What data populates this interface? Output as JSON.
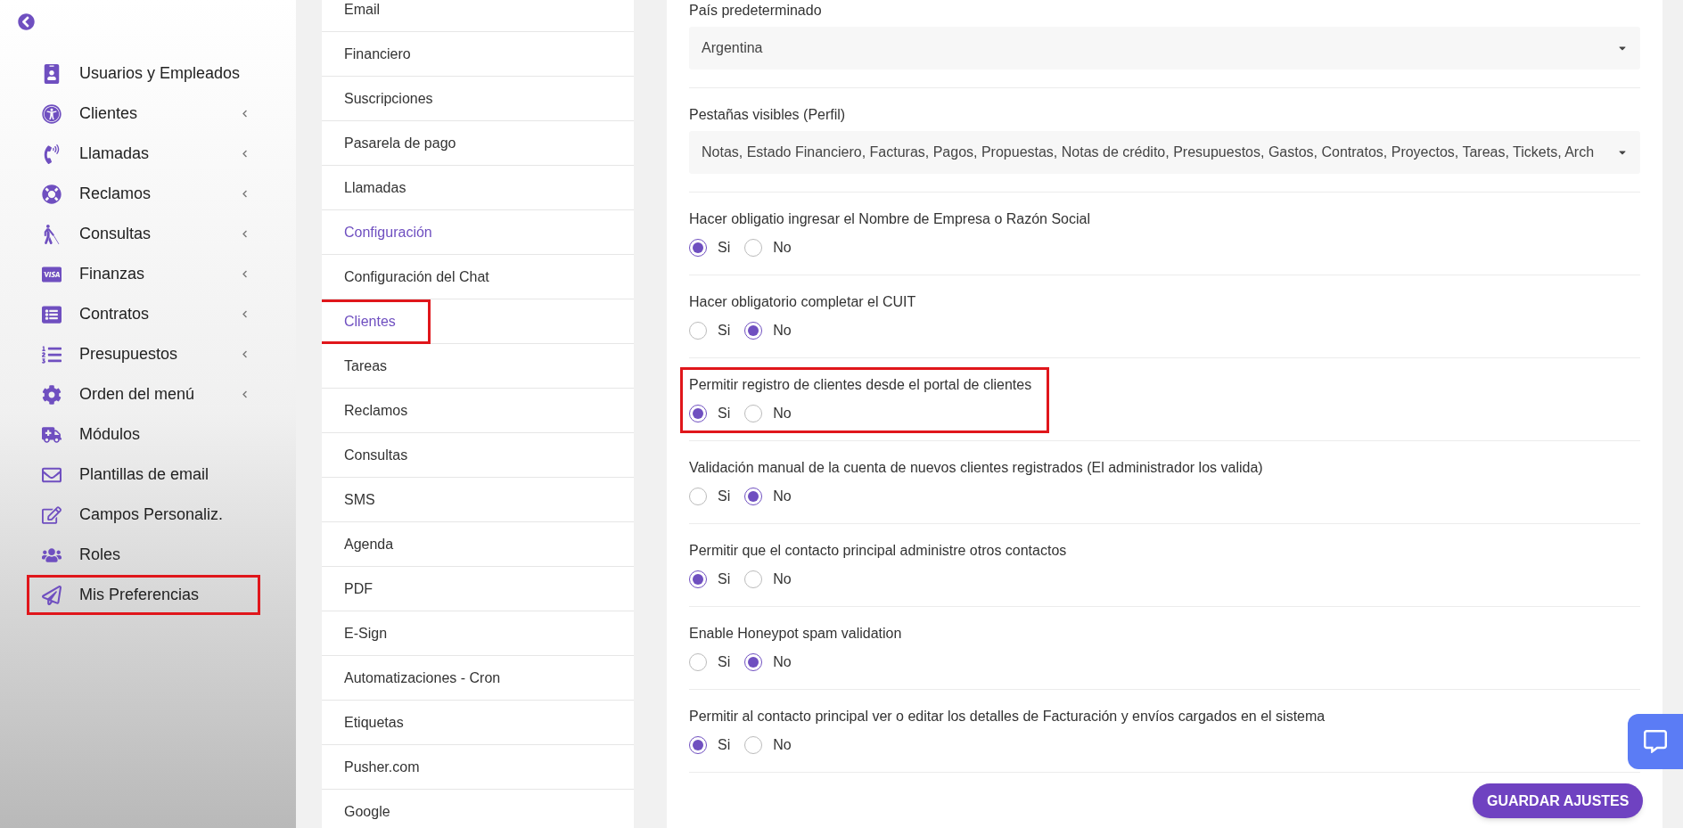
{
  "sidebar": {
    "items": [
      {
        "label": "Usuarios y Empleados",
        "has_submenu": false,
        "highlighted": false
      },
      {
        "label": "Clientes",
        "has_submenu": true,
        "highlighted": false
      },
      {
        "label": "Llamadas",
        "has_submenu": true,
        "highlighted": false
      },
      {
        "label": "Reclamos",
        "has_submenu": true,
        "highlighted": false
      },
      {
        "label": "Consultas",
        "has_submenu": true,
        "highlighted": false
      },
      {
        "label": "Finanzas",
        "has_submenu": true,
        "highlighted": false
      },
      {
        "label": "Contratos",
        "has_submenu": true,
        "highlighted": false
      },
      {
        "label": "Presupuestos",
        "has_submenu": true,
        "highlighted": false
      },
      {
        "label": "Orden del menú",
        "has_submenu": true,
        "highlighted": false
      },
      {
        "label": "Módulos",
        "has_submenu": false,
        "highlighted": false
      },
      {
        "label": "Plantillas de email",
        "has_submenu": false,
        "highlighted": false
      },
      {
        "label": "Campos Personaliz.",
        "has_submenu": false,
        "highlighted": false
      },
      {
        "label": "Roles",
        "has_submenu": false,
        "highlighted": false
      },
      {
        "label": "Mis Preferencias",
        "has_submenu": false,
        "highlighted": true
      }
    ]
  },
  "settings_menu": {
    "items": [
      {
        "label": "Email",
        "selected": false,
        "highlighted": false
      },
      {
        "label": "Financiero",
        "selected": false,
        "highlighted": false
      },
      {
        "label": "Suscripciones",
        "selected": false,
        "highlighted": false
      },
      {
        "label": "Pasarela de pago",
        "selected": false,
        "highlighted": false
      },
      {
        "label": "Llamadas",
        "selected": false,
        "highlighted": false
      },
      {
        "label": "Configuración",
        "selected": true,
        "highlighted": false
      },
      {
        "label": "Configuración del Chat",
        "selected": false,
        "highlighted": false
      },
      {
        "label": "Clientes",
        "selected": true,
        "highlighted": true
      },
      {
        "label": "Tareas",
        "selected": false,
        "highlighted": false
      },
      {
        "label": "Reclamos",
        "selected": false,
        "highlighted": false
      },
      {
        "label": "Consultas",
        "selected": false,
        "highlighted": false
      },
      {
        "label": "SMS",
        "selected": false,
        "highlighted": false
      },
      {
        "label": "Agenda",
        "selected": false,
        "highlighted": false
      },
      {
        "label": "PDF",
        "selected": false,
        "highlighted": false
      },
      {
        "label": "E-Sign",
        "selected": false,
        "highlighted": false
      },
      {
        "label": "Automatizaciones - Cron",
        "selected": false,
        "highlighted": false
      },
      {
        "label": "Etiquetas",
        "selected": false,
        "highlighted": false
      },
      {
        "label": "Pusher.com",
        "selected": false,
        "highlighted": false
      },
      {
        "label": "Google",
        "selected": false,
        "highlighted": false
      }
    ]
  },
  "settings": {
    "fields": [
      {
        "kind": "select",
        "label": "País predeterminado",
        "value": "Argentina"
      },
      {
        "kind": "select",
        "label": "Pestañas visibles (Perfil)",
        "value": "Notas, Estado Financiero, Facturas, Pagos, Propuestas, Notas de crédito, Presupuestos, Gastos, Contratos, Proyectos, Tareas, Tickets, Arch"
      },
      {
        "kind": "radio",
        "label": "Hacer obligatio ingresar el Nombre de Empresa o Razón Social",
        "highlighted": false,
        "options": [
          {
            "label": "Si",
            "selected": true
          },
          {
            "label": "No",
            "selected": false
          }
        ]
      },
      {
        "kind": "radio",
        "label": "Hacer obligatorio completar el CUIT",
        "highlighted": false,
        "options": [
          {
            "label": "Si",
            "selected": false
          },
          {
            "label": "No",
            "selected": true
          }
        ]
      },
      {
        "kind": "radio",
        "label": "Permitir registro de clientes desde el portal de clientes",
        "highlighted": true,
        "options": [
          {
            "label": "Si",
            "selected": true
          },
          {
            "label": "No",
            "selected": false
          }
        ]
      },
      {
        "kind": "radio",
        "label": "Validación manual de la cuenta de nuevos clientes registrados (El administrador los valida)",
        "highlighted": false,
        "options": [
          {
            "label": "Si",
            "selected": false
          },
          {
            "label": "No",
            "selected": true
          }
        ]
      },
      {
        "kind": "radio",
        "label": "Permitir que el contacto principal administre otros contactos",
        "highlighted": false,
        "options": [
          {
            "label": "Si",
            "selected": true
          },
          {
            "label": "No",
            "selected": false
          }
        ]
      },
      {
        "kind": "radio",
        "label": "Enable Honeypot spam validation",
        "highlighted": false,
        "options": [
          {
            "label": "Si",
            "selected": false
          },
          {
            "label": "No",
            "selected": true
          }
        ]
      },
      {
        "kind": "radio",
        "label": "Permitir al contacto principal ver o editar los detalles de Facturación y envíos cargados en el sistema",
        "highlighted": false,
        "options": [
          {
            "label": "Si",
            "selected": true
          },
          {
            "label": "No",
            "selected": false
          }
        ]
      }
    ]
  },
  "save_button": "GUARDAR AJUSTES"
}
